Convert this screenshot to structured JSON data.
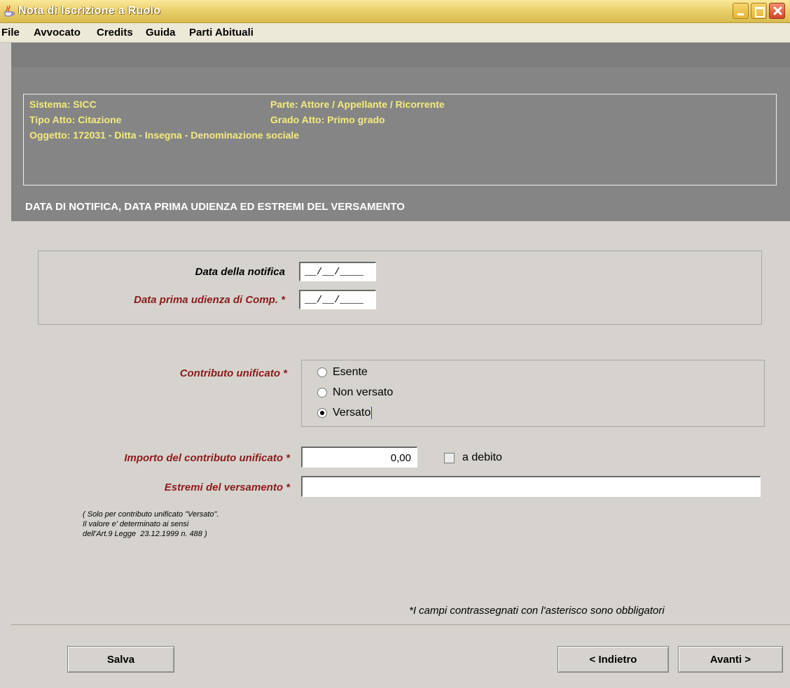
{
  "window": {
    "title": "Nota di Iscrizione a Ruolo",
    "app_icon": "java-coffee-cup-icon"
  },
  "menu": [
    "File",
    "Avvocato",
    "Credits",
    "Guida",
    "Parti Abituali"
  ],
  "info": {
    "sistema": "Sistema: SICC",
    "parte": "Parte: Attore / Appellante / Ricorrente",
    "tipo_atto": "Tipo Atto: Citazione",
    "grado_atto": "Grado Atto: Primo grado",
    "oggetto": "Oggetto: 172031 - Ditta - Insegna - Denominazione sociale"
  },
  "section_title": "DATA DI NOTIFICA, DATA PRIMA UDIENZA ED ESTREMI DEL VERSAMENTO",
  "form": {
    "data_notifica_label": "Data della notifica",
    "data_notifica_value": "__/__/____",
    "data_udienza_label": "Data prima udienza di Comp. *",
    "data_udienza_value": "__/__/____",
    "contributo_label": "Contributo unificato *",
    "contributo_options": [
      "Esente",
      "Non versato",
      "Versato"
    ],
    "contributo_selected": "Versato",
    "importo_label": "Importo del contributo unificato *",
    "importo_value": "0,00",
    "a_debito_label": "a debito",
    "estremi_label": "Estremi del versamento *",
    "estremi_value": "",
    "note": "( Solo per contributo unificato \"Versato\".\nIl valore e' determinato ai sensi\ndell'Art.9 Legge  23.12.1999 n. 488 )",
    "footnote": "*I campi contrassegnati con l'asterisco sono obbligatori"
  },
  "buttons": {
    "salva": "Salva",
    "indietro": "< Indietro",
    "avanti": "Avanti >"
  },
  "colors": {
    "titlebar": "#e9cf6a",
    "header_panel": "#858585",
    "info_text": "#f4ec7d",
    "required_label": "#8b1a1a",
    "background": "#d6d3ce"
  }
}
